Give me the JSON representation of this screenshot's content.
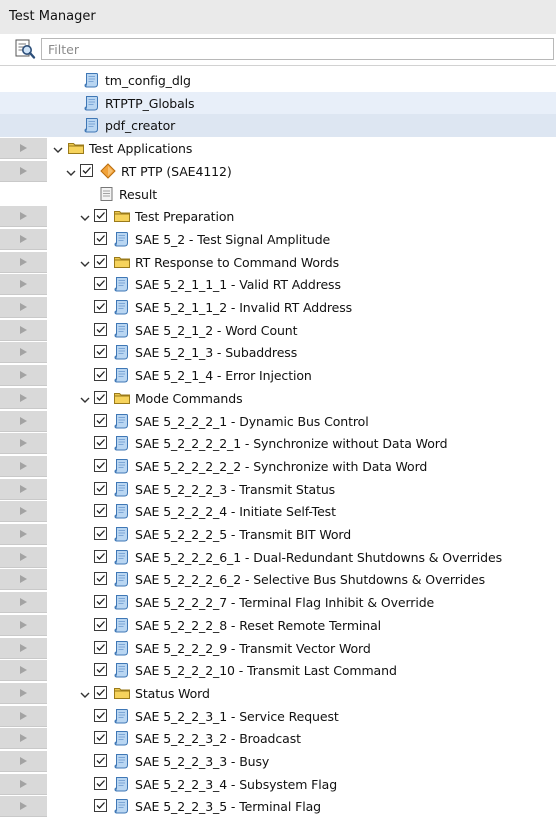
{
  "window": {
    "title": "Test Manager"
  },
  "filter": {
    "placeholder": "Filter"
  },
  "tree": [
    {
      "label": "tm_config_dlg",
      "icon": "script",
      "level": 2,
      "checkbox": false,
      "expander": false,
      "gutter": false
    },
    {
      "label": "RTPTP_Globals",
      "icon": "script",
      "level": 2,
      "checkbox": false,
      "expander": false,
      "gutter": false,
      "selected": "light"
    },
    {
      "label": "pdf_creator",
      "icon": "script",
      "level": 2,
      "checkbox": false,
      "expander": false,
      "gutter": false,
      "selected": "dark"
    },
    {
      "label": "Test Applications",
      "icon": "folder",
      "level": 0,
      "checkbox": false,
      "expander": true,
      "gutter": true
    },
    {
      "label": "RT PTP (SAE4112)",
      "icon": "diamond",
      "level": 1,
      "checkbox": true,
      "expander": true,
      "gutter": true
    },
    {
      "label": "Result",
      "icon": "doc",
      "level": 1.7,
      "checkbox": false,
      "expander": false,
      "gutter": false
    },
    {
      "label": "Test Preparation",
      "icon": "folder",
      "level": 2,
      "checkbox": true,
      "expander": true,
      "gutter": true
    },
    {
      "label": "SAE 5_2 - Test Signal Amplitude",
      "icon": "script",
      "level": 3,
      "checkbox": true,
      "expander": false,
      "gutter": true
    },
    {
      "label": "RT Response to Command Words",
      "icon": "folder",
      "level": 2,
      "checkbox": true,
      "expander": true,
      "gutter": true
    },
    {
      "label": "SAE 5_2_1_1_1 - Valid RT Address",
      "icon": "script",
      "level": 3,
      "checkbox": true,
      "expander": false,
      "gutter": true
    },
    {
      "label": "SAE 5_2_1_1_2 - Invalid RT Address",
      "icon": "script",
      "level": 3,
      "checkbox": true,
      "expander": false,
      "gutter": true
    },
    {
      "label": "SAE 5_2_1_2 - Word Count",
      "icon": "script",
      "level": 3,
      "checkbox": true,
      "expander": false,
      "gutter": true
    },
    {
      "label": "SAE 5_2_1_3 - Subaddress",
      "icon": "script",
      "level": 3,
      "checkbox": true,
      "expander": false,
      "gutter": true
    },
    {
      "label": "SAE 5_2_1_4 - Error Injection",
      "icon": "script",
      "level": 3,
      "checkbox": true,
      "expander": false,
      "gutter": true
    },
    {
      "label": "Mode Commands",
      "icon": "folder",
      "level": 2,
      "checkbox": true,
      "expander": true,
      "gutter": true
    },
    {
      "label": "SAE 5_2_2_2_1 - Dynamic Bus Control",
      "icon": "script",
      "level": 3,
      "checkbox": true,
      "expander": false,
      "gutter": true
    },
    {
      "label": "SAE 5_2_2_2_2_1 - Synchronize without Data Word",
      "icon": "script",
      "level": 3,
      "checkbox": true,
      "expander": false,
      "gutter": true
    },
    {
      "label": "SAE 5_2_2_2_2_2 - Synchronize with Data Word",
      "icon": "script",
      "level": 3,
      "checkbox": true,
      "expander": false,
      "gutter": true
    },
    {
      "label": "SAE 5_2_2_2_3 - Transmit Status",
      "icon": "script",
      "level": 3,
      "checkbox": true,
      "expander": false,
      "gutter": true
    },
    {
      "label": "SAE 5_2_2_2_4 - Initiate Self-Test",
      "icon": "script",
      "level": 3,
      "checkbox": true,
      "expander": false,
      "gutter": true
    },
    {
      "label": "SAE 5_2_2_2_5 - Transmit BIT Word",
      "icon": "script",
      "level": 3,
      "checkbox": true,
      "expander": false,
      "gutter": true
    },
    {
      "label": "SAE 5_2_2_2_6_1 - Dual-Redundant Shutdowns & Overrides",
      "icon": "script",
      "level": 3,
      "checkbox": true,
      "expander": false,
      "gutter": true
    },
    {
      "label": "SAE 5_2_2_2_6_2 - Selective Bus Shutdowns & Overrides",
      "icon": "script",
      "level": 3,
      "checkbox": true,
      "expander": false,
      "gutter": true
    },
    {
      "label": "SAE 5_2_2_2_7 - Terminal Flag Inhibit & Override",
      "icon": "script",
      "level": 3,
      "checkbox": true,
      "expander": false,
      "gutter": true
    },
    {
      "label": "SAE 5_2_2_2_8 - Reset Remote Terminal",
      "icon": "script",
      "level": 3,
      "checkbox": true,
      "expander": false,
      "gutter": true
    },
    {
      "label": "SAE 5_2_2_2_9 - Transmit Vector Word",
      "icon": "script",
      "level": 3,
      "checkbox": true,
      "expander": false,
      "gutter": true
    },
    {
      "label": "SAE 5_2_2_2_10 - Transmit Last Command",
      "icon": "script",
      "level": 3,
      "checkbox": true,
      "expander": false,
      "gutter": true
    },
    {
      "label": "Status Word",
      "icon": "folder",
      "level": 2,
      "checkbox": true,
      "expander": true,
      "gutter": true
    },
    {
      "label": "SAE 5_2_2_3_1 - Service Request",
      "icon": "script",
      "level": 3,
      "checkbox": true,
      "expander": false,
      "gutter": true
    },
    {
      "label": "SAE 5_2_2_3_2 - Broadcast",
      "icon": "script",
      "level": 3,
      "checkbox": true,
      "expander": false,
      "gutter": true
    },
    {
      "label": "SAE 5_2_2_3_3 - Busy",
      "icon": "script",
      "level": 3,
      "checkbox": true,
      "expander": false,
      "gutter": true
    },
    {
      "label": "SAE 5_2_2_3_4 - Subsystem Flag",
      "icon": "script",
      "level": 3,
      "checkbox": true,
      "expander": false,
      "gutter": true
    },
    {
      "label": "SAE 5_2_2_3_5 - Terminal Flag",
      "icon": "script",
      "level": 3,
      "checkbox": true,
      "expander": false,
      "gutter": true
    }
  ]
}
